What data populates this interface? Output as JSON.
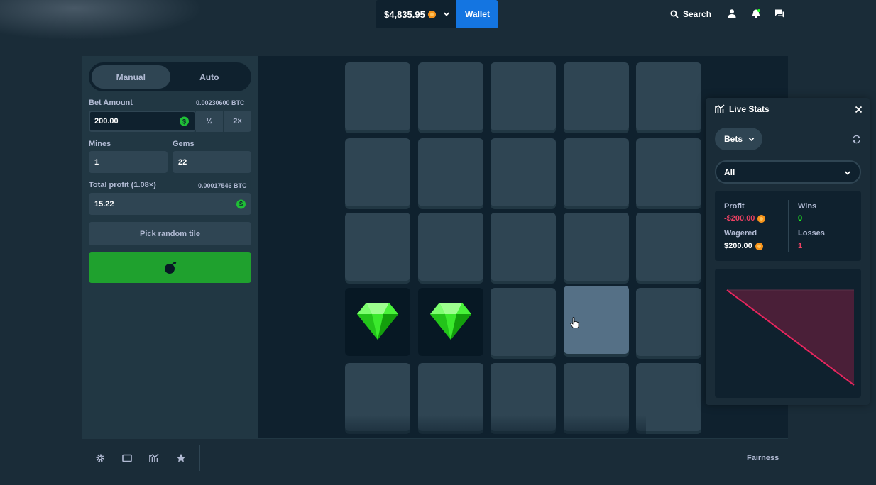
{
  "header": {
    "balance": "$4,835.95",
    "wallet_label": "Wallet",
    "search_label": "Search"
  },
  "bet_panel": {
    "tabs": [
      {
        "label": "Manual",
        "active": true
      },
      {
        "label": "Auto",
        "active": false
      }
    ],
    "bet_amount_label": "Bet Amount",
    "bet_amount_btc": "0.00230600 BTC",
    "bet_amount_value": "200.00",
    "half_label": "½",
    "double_label": "2×",
    "mines_label": "Mines",
    "mines_value": "1",
    "gems_label": "Gems",
    "gems_value": "22",
    "total_profit_label": "Total profit (1.08×)",
    "total_profit_btc": "0.00017546 BTC",
    "total_profit_value": "15.22",
    "pick_random_label": "Pick random tile",
    "bet_button_icon": "bomb-icon"
  },
  "board": {
    "rows": 5,
    "cols": 5,
    "revealed_gems": [
      [
        3,
        0
      ],
      [
        3,
        1
      ]
    ],
    "hovered_tile": [
      3,
      3
    ],
    "gem_color": "#1fe01f"
  },
  "footer": {
    "icons": [
      "gear-icon",
      "theatre-icon",
      "stats-icon",
      "star-icon"
    ],
    "fairness_label": "Fairness"
  },
  "live_stats": {
    "title": "Live Stats",
    "filter_label": "Bets",
    "range_label": "All",
    "profit_label": "Profit",
    "profit_value": "-$200.00",
    "wagered_label": "Wagered",
    "wagered_value": "$200.00",
    "wins_label": "Wins",
    "wins_value": "0",
    "losses_label": "Losses",
    "losses_value": "1",
    "profit_color": "#ed4163",
    "wins_color": "#1fff20"
  },
  "chart_data": {
    "type": "area",
    "x": [
      0,
      1
    ],
    "y": [
      0,
      -200
    ],
    "title": "",
    "xlabel": "",
    "ylabel": "",
    "ylim": [
      -200,
      0
    ]
  }
}
